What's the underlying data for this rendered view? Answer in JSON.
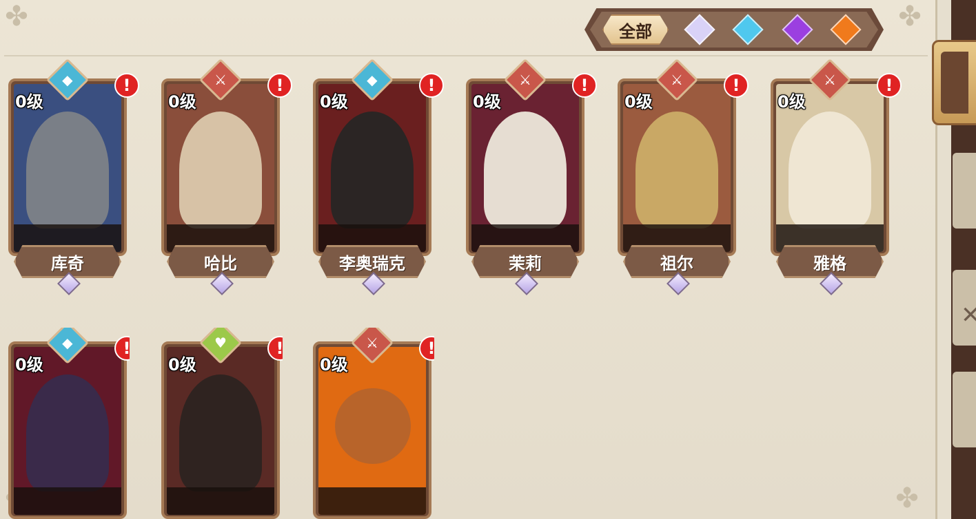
{
  "filters": {
    "all_label": "全部",
    "gems": [
      {
        "name": "white-gem",
        "color": "#d9d2f7"
      },
      {
        "name": "blue-gem",
        "color": "#4fc8ee"
      },
      {
        "name": "purple-gem",
        "color": "#9b3fe0"
      },
      {
        "name": "orange-gem",
        "color": "#f07a1c"
      }
    ]
  },
  "heroes": [
    {
      "name": "库奇",
      "level": "0级",
      "class_icon": "shield-icon",
      "class_color": "#4bb7d6",
      "bg": "#3a4f80",
      "figure": "#7a7f87",
      "alert": "!"
    },
    {
      "name": "哈比",
      "level": "0级",
      "class_icon": "sword-icon",
      "class_color": "#c9574a",
      "bg": "#8a4e3b",
      "figure": "#d7c2a6",
      "alert": "!"
    },
    {
      "name": "李奥瑞克",
      "level": "0级",
      "class_icon": "shield-icon",
      "class_color": "#4bb7d6",
      "bg": "#6a1f1f",
      "figure": "#2b2524",
      "alert": "!"
    },
    {
      "name": "茉莉",
      "level": "0级",
      "class_icon": "sword-icon",
      "class_color": "#c9574a",
      "bg": "#6a2232",
      "figure": "#e6ddd2",
      "alert": "!"
    },
    {
      "name": "祖尔",
      "level": "0级",
      "class_icon": "sword-icon",
      "class_color": "#c9574a",
      "bg": "#9b5b3f",
      "figure": "#c9a865",
      "alert": "!"
    },
    {
      "name": "雅格",
      "level": "0级",
      "class_icon": "sword-icon",
      "class_color": "#c9574a",
      "bg": "#d8c8a6",
      "figure": "#efe6d3",
      "alert": "!"
    },
    {
      "name": "",
      "level": "0级",
      "class_icon": "shield-icon",
      "class_color": "#4bb7d6",
      "bg": "#611828",
      "figure": "#3a2a4a",
      "alert": "!"
    },
    {
      "name": "",
      "level": "0级",
      "class_icon": "heart-icon",
      "class_color": "#9cc94a",
      "bg": "#5a2a25",
      "figure": "#2f2320",
      "alert": "!"
    },
    {
      "name": "",
      "level": "0级",
      "class_icon": "sword-icon",
      "class_color": "#c9574a",
      "bg": "#e06a12",
      "figure": "#b8642a",
      "alert": "!"
    }
  ]
}
